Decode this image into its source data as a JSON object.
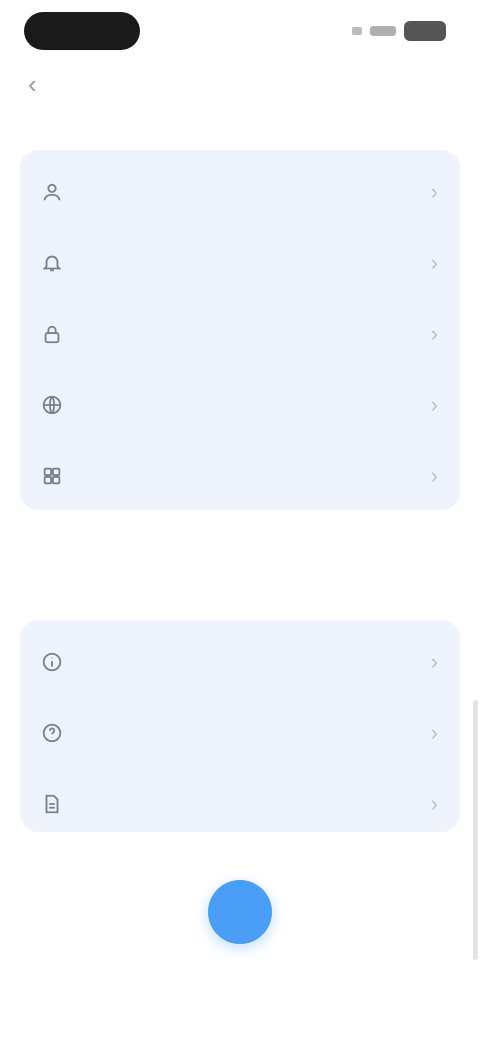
{
  "nav": {
    "back_label": ""
  },
  "settings": {
    "group_1": [
      {
        "label": "",
        "icon": "person-icon"
      },
      {
        "label": "",
        "icon": "bell-icon"
      },
      {
        "label": "",
        "icon": "lock-icon"
      },
      {
        "label": "",
        "icon": "globe-icon"
      },
      {
        "label": "",
        "icon": "grid-icon"
      }
    ],
    "section_2_title": "",
    "group_2": [
      {
        "label": "",
        "icon": "info-icon"
      },
      {
        "label": "",
        "icon": "help-icon"
      },
      {
        "label": "",
        "icon": "document-icon"
      }
    ]
  },
  "footer": {
    "caption_1": "",
    "caption_2": ""
  },
  "colors": {
    "accent": "#4a9ef5",
    "group_background": "#eef3fc",
    "page_background": "#ffffff"
  }
}
